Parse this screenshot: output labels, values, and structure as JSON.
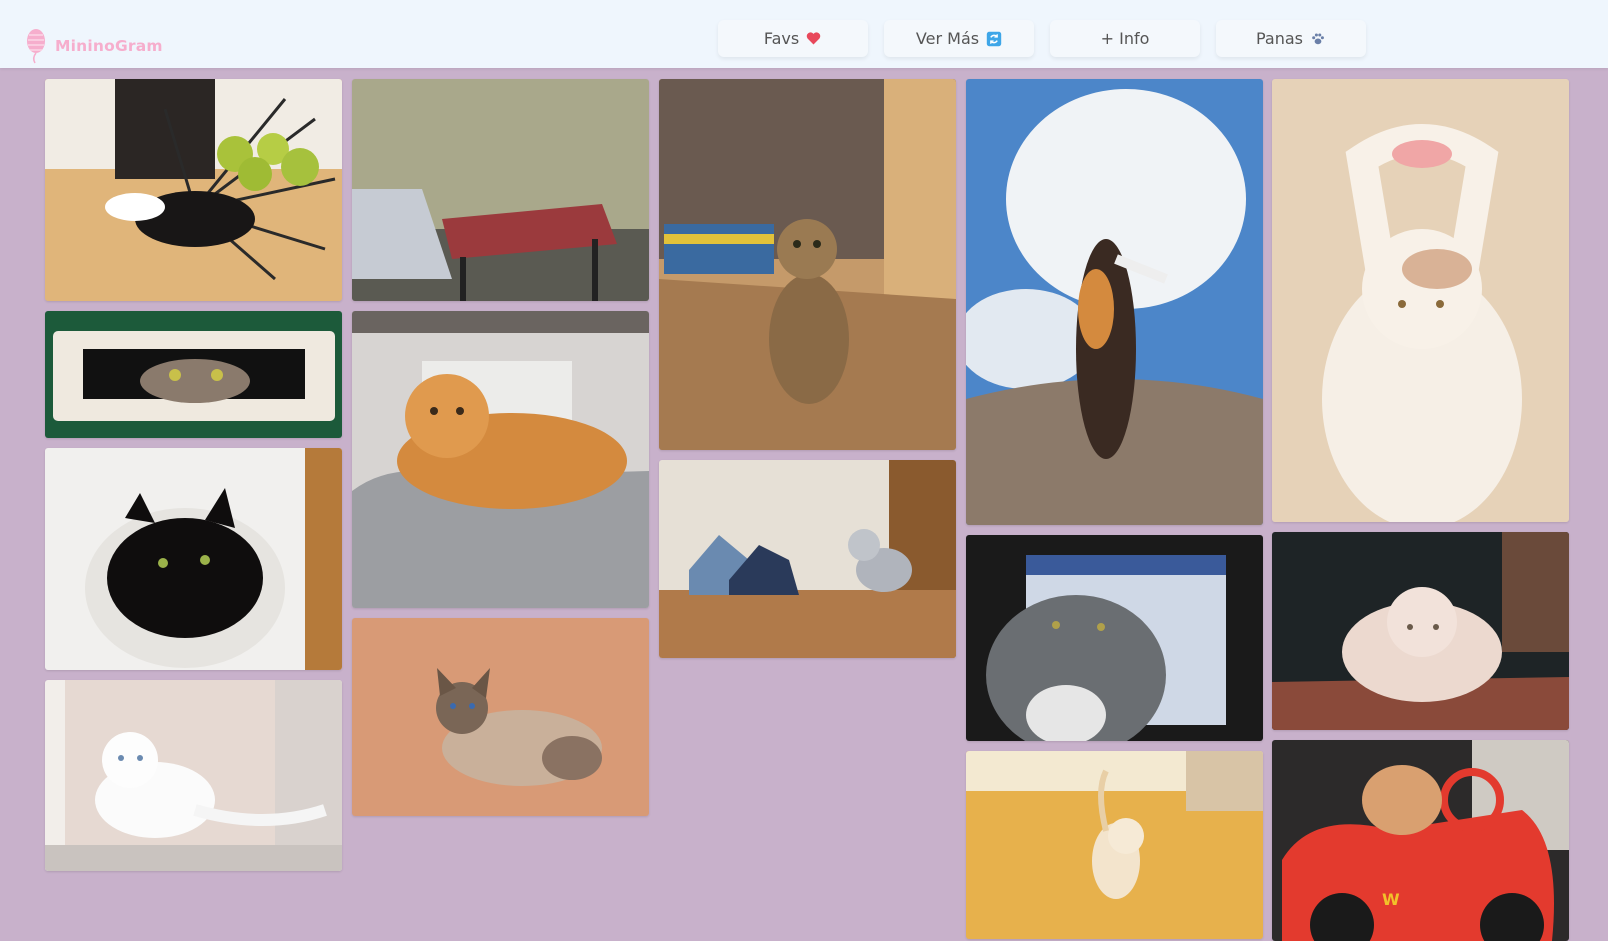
{
  "brand": {
    "name": "MininoGram",
    "icon": "yarn-ball-icon",
    "color": "#f6aecd"
  },
  "nav": [
    {
      "label": "Favs",
      "icon": "heart-icon"
    },
    {
      "label": "Ver Más",
      "icon": "refresh-icon"
    },
    {
      "label": "+ Info",
      "icon": ""
    },
    {
      "label": "Panas",
      "icon": "paw-icon"
    }
  ],
  "colors": {
    "page_background": "#c8b1cb",
    "topbar_background": "#eff6fd"
  },
  "gallery": [
    {
      "subject": "cat-photo-tuxedo-fruit-bowl",
      "colors": [
        "#e0b57a",
        "#f1ece4",
        "#333"
      ]
    },
    {
      "subject": "cat-photo-red-stool",
      "colors": [
        "#a9a88b",
        "#9b3a3d",
        "#5a5a52"
      ]
    },
    {
      "subject": "cat-photo-tabby-kitchen",
      "colors": [
        "#a57a50",
        "#6a5a50",
        "#c59a6a"
      ]
    },
    {
      "subject": "cat-photo-calico-sky",
      "colors": [
        "#4c86c9",
        "#f0f3f6",
        "#8c7a6a"
      ]
    },
    {
      "subject": "cat-photo-white-stretch",
      "colors": [
        "#e6d2b8",
        "#f6efe6",
        "#d9b296"
      ]
    },
    {
      "subject": "cat-photo-mail-slot",
      "colors": [
        "#1c5a3a",
        "#efe9df",
        "#7a6a5a"
      ]
    },
    {
      "subject": "cat-photo-orange-sofa",
      "colors": [
        "#d7d4d2",
        "#d48a3e",
        "#9c9ea2"
      ]
    },
    {
      "subject": "cat-photo-shoelace-kitten",
      "colors": [
        "#e6e0d6",
        "#8a5a2e",
        "#6a8ab0"
      ]
    },
    {
      "subject": "cat-photo-tabby-monitor",
      "colors": [
        "#1a1a1a",
        "#6a6e72",
        "#cfd8e6"
      ]
    },
    {
      "subject": "cat-photo-white-rug",
      "colors": [
        "#1e2426",
        "#ecd9cf",
        "#6a4a3a"
      ]
    },
    {
      "subject": "cat-photo-black-blanket",
      "colors": [
        "#f1f0ee",
        "#0f0d0d",
        "#b57a3a"
      ]
    },
    {
      "subject": "cat-photo-sphynx-peach",
      "colors": [
        "#d89a76",
        "#7a6656",
        "#c9b09a"
      ]
    },
    {
      "subject": "cat-photo-kitten-floor",
      "colors": [
        "#e7b14c",
        "#f3e9d1",
        "#d8c4a6"
      ]
    },
    {
      "subject": "cat-photo-toy-car",
      "colors": [
        "#e33a2e",
        "#2c2a2a",
        "#f2c12a"
      ]
    },
    {
      "subject": "cat-photo-white-kitten-window",
      "colors": [
        "#f2eeea",
        "#c9c3bf",
        "#8a7a72"
      ]
    }
  ]
}
